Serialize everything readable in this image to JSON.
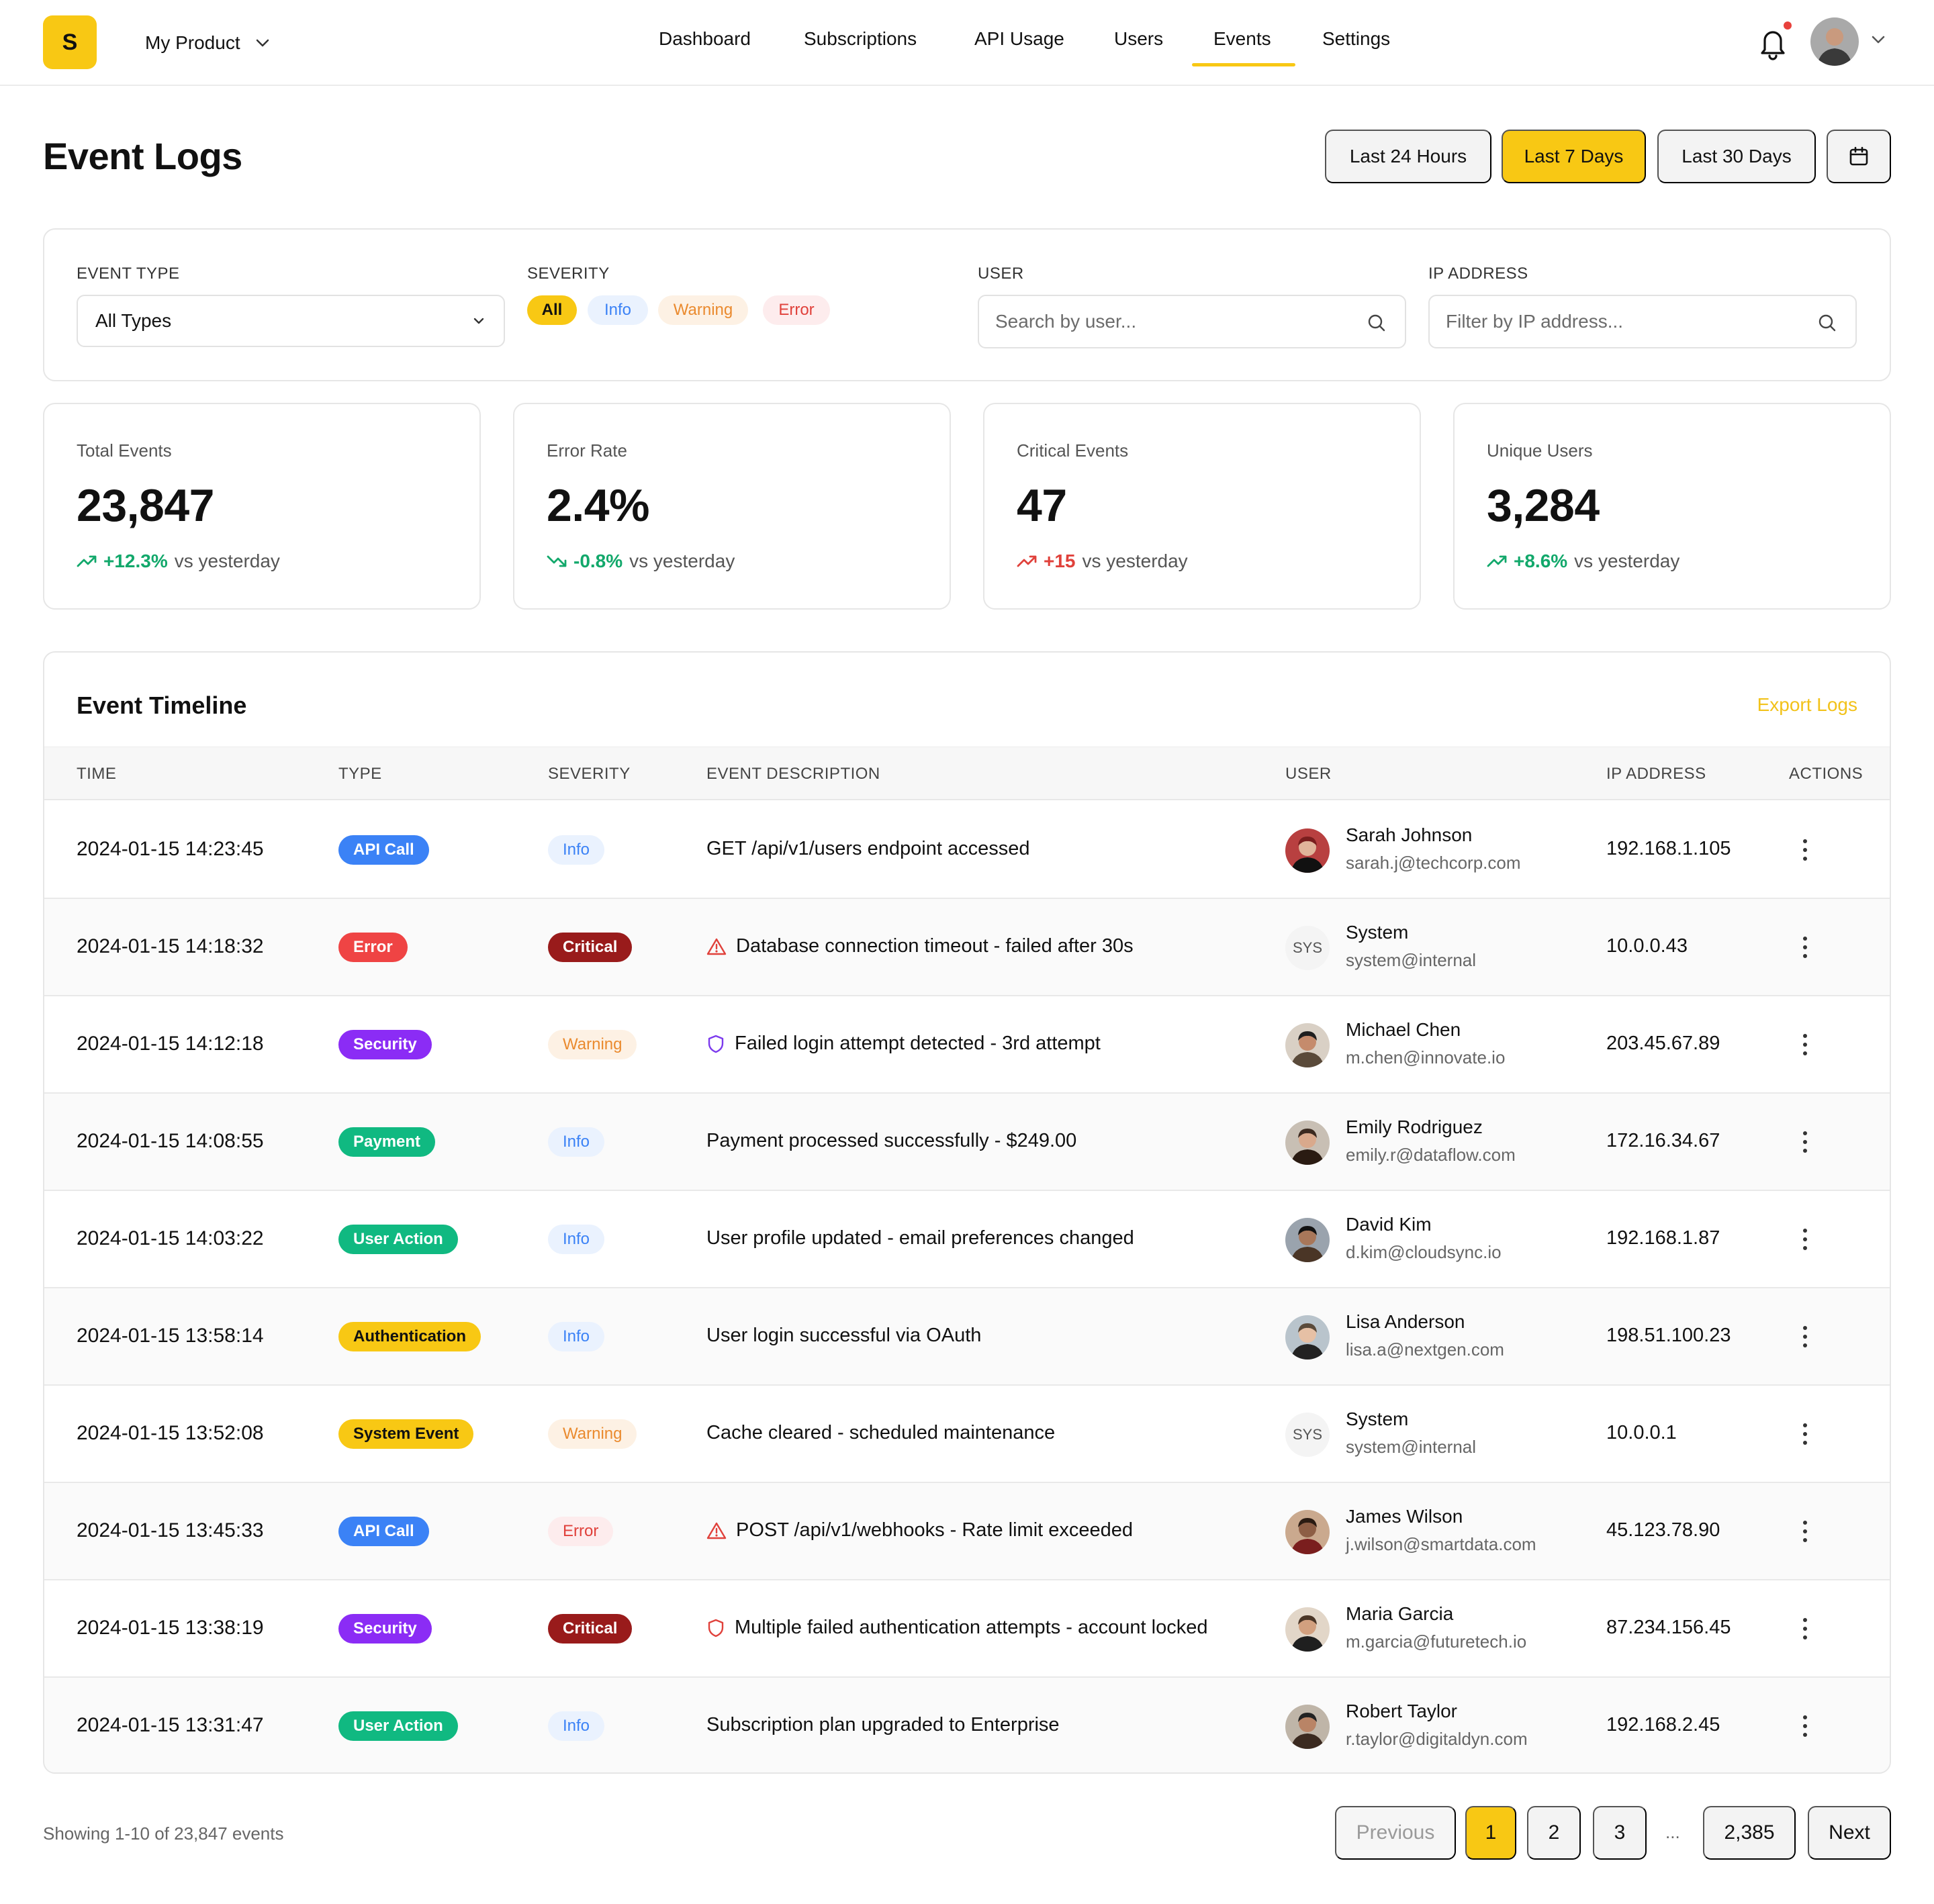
{
  "app": {
    "logo_letter": "S",
    "product_name": "My Product",
    "notification_dot_color": "#e8413c",
    "brand_color": "#f8c814"
  },
  "nav": {
    "items": [
      "Dashboard",
      "Subscriptions",
      "API Usage",
      "Users",
      "Events",
      "Settings"
    ],
    "active": "Events"
  },
  "header": {
    "title": "Event Logs",
    "ranges": [
      "Last 24 Hours",
      "Last 7 Days",
      "Last 30 Days"
    ],
    "active_range": "Last 7 Days"
  },
  "filters": {
    "event_type_label": "EVENT TYPE",
    "event_type_value": "All Types",
    "severity_label": "SEVERITY",
    "severity_options": [
      "All",
      "Info",
      "Warning",
      "Error"
    ],
    "severity_active": "All",
    "user_label": "USER",
    "user_placeholder": "Search by user...",
    "ip_label": "IP ADDRESS",
    "ip_placeholder": "Filter by IP address..."
  },
  "stats": [
    {
      "label": "Total Events",
      "value": "23,847",
      "delta": "+12.3%",
      "suffix": "vs yesterday",
      "trend": "up",
      "tone": "green"
    },
    {
      "label": "Error Rate",
      "value": "2.4%",
      "delta": "-0.8%",
      "suffix": "vs yesterday",
      "trend": "down",
      "tone": "green"
    },
    {
      "label": "Critical Events",
      "value": "47",
      "delta": "+15",
      "suffix": "vs yesterday",
      "trend": "up",
      "tone": "red"
    },
    {
      "label": "Unique Users",
      "value": "3,284",
      "delta": "+8.6%",
      "suffix": "vs yesterday",
      "trend": "up",
      "tone": "green"
    }
  ],
  "timeline": {
    "title": "Event Timeline",
    "export_label": "Export Logs",
    "columns": [
      "TIME",
      "TYPE",
      "SEVERITY",
      "EVENT DESCRIPTION",
      "USER",
      "IP ADDRESS",
      "ACTIONS"
    ],
    "rows": [
      {
        "time": "2024-01-15 14:23:45",
        "type": "API Call",
        "severity": "Info",
        "icon": "",
        "description": "GET /api/v1/users endpoint accessed",
        "user": "Sarah Johnson",
        "email": "sarah.j@techcorp.com",
        "ip": "192.168.1.105",
        "avatar": "photo"
      },
      {
        "time": "2024-01-15 14:18:32",
        "type": "Error",
        "severity": "Critical",
        "icon": "warning-triangle-icon",
        "description": "Database connection timeout - failed after 30s",
        "user": "System",
        "email": "system@internal",
        "ip": "10.0.0.43",
        "avatar": "SYS"
      },
      {
        "time": "2024-01-15 14:12:18",
        "type": "Security",
        "severity": "Warning",
        "icon": "shield-icon",
        "description": "Failed login attempt detected - 3rd attempt",
        "user": "Michael Chen",
        "email": "m.chen@innovate.io",
        "ip": "203.45.67.89",
        "avatar": "photo"
      },
      {
        "time": "2024-01-15 14:08:55",
        "type": "Payment",
        "severity": "Info",
        "icon": "",
        "description": "Payment processed successfully - $249.00",
        "user": "Emily Rodriguez",
        "email": "emily.r@dataflow.com",
        "ip": "172.16.34.67",
        "avatar": "photo"
      },
      {
        "time": "2024-01-15 14:03:22",
        "type": "User Action",
        "severity": "Info",
        "icon": "",
        "description": "User profile updated - email preferences changed",
        "user": "David Kim",
        "email": "d.kim@cloudsync.io",
        "ip": "192.168.1.87",
        "avatar": "photo"
      },
      {
        "time": "2024-01-15 13:58:14",
        "type": "Authentication",
        "severity": "Info",
        "icon": "",
        "description": "User login successful via OAuth",
        "user": "Lisa Anderson",
        "email": "lisa.a@nextgen.com",
        "ip": "198.51.100.23",
        "avatar": "photo"
      },
      {
        "time": "2024-01-15 13:52:08",
        "type": "System Event",
        "severity": "Warning",
        "icon": "",
        "description": "Cache cleared - scheduled maintenance",
        "user": "System",
        "email": "system@internal",
        "ip": "10.0.0.1",
        "avatar": "SYS"
      },
      {
        "time": "2024-01-15 13:45:33",
        "type": "API Call",
        "severity": "Error",
        "icon": "warning-triangle-icon",
        "description": "POST /api/v1/webhooks - Rate limit exceeded",
        "user": "James Wilson",
        "email": "j.wilson@smartdata.com",
        "ip": "45.123.78.90",
        "avatar": "photo"
      },
      {
        "time": "2024-01-15 13:38:19",
        "type": "Security",
        "severity": "Critical",
        "icon": "shield-icon",
        "description": "Multiple failed authentication attempts - account locked",
        "user": "Maria Garcia",
        "email": "m.garcia@futuretech.io",
        "ip": "87.234.156.45",
        "avatar": "photo"
      },
      {
        "time": "2024-01-15 13:31:47",
        "type": "User Action",
        "severity": "Info",
        "icon": "",
        "description": "Subscription plan upgraded to Enterprise",
        "user": "Robert Taylor",
        "email": "r.taylor@digitaldyn.com",
        "ip": "192.168.2.45",
        "avatar": "photo"
      }
    ]
  },
  "type_colors": {
    "API Call": {
      "bg": "#3b82f6",
      "fg": "#ffffff"
    },
    "Error": {
      "bg": "#ef4444",
      "fg": "#ffffff"
    },
    "Security": {
      "bg": "#8b2cf5",
      "fg": "#ffffff"
    },
    "Payment": {
      "bg": "#10b981",
      "fg": "#ffffff"
    },
    "User Action": {
      "bg": "#10b981",
      "fg": "#ffffff"
    },
    "Authentication": {
      "bg": "#f8c814",
      "fg": "#111111"
    },
    "System Event": {
      "bg": "#f8c814",
      "fg": "#111111"
    }
  },
  "severity_colors": {
    "Info": {
      "bg": "#eaf2fe",
      "fg": "#3b82f6"
    },
    "Critical": {
      "bg": "#991b1b",
      "fg": "#ffffff"
    },
    "Warning": {
      "bg": "#fdf1e4",
      "fg": "#ea8a2e"
    },
    "Error": {
      "bg": "#fdeced",
      "fg": "#e0413b"
    }
  },
  "pagination": {
    "showing": "Showing 1-10 of 23,847 events",
    "previous": "Previous",
    "pages": [
      "1",
      "2",
      "3"
    ],
    "ellipsis": "...",
    "last": "2,385",
    "next": "Next",
    "current": "1"
  }
}
